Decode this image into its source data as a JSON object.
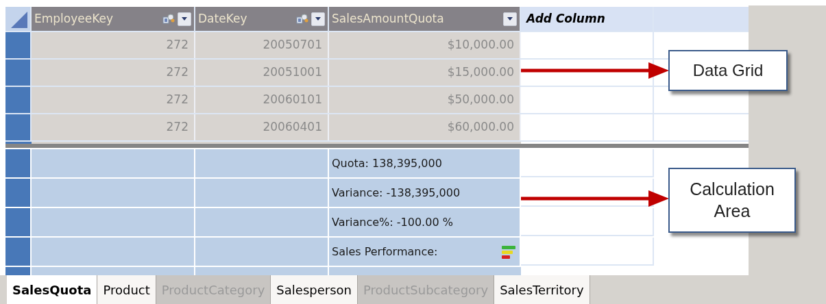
{
  "columns": [
    {
      "label": "EmployeeKey",
      "has_relationship": true,
      "has_filter": true
    },
    {
      "label": "DateKey",
      "has_relationship": true,
      "has_filter": true
    },
    {
      "label": "SalesAmountQuota",
      "has_relationship": false,
      "has_filter": true
    }
  ],
  "add_column": "Add Column",
  "rows": [
    [
      "272",
      "20050701",
      "$10,000.00"
    ],
    [
      "272",
      "20051001",
      "$15,000.00"
    ],
    [
      "272",
      "20060101",
      "$50,000.00"
    ],
    [
      "272",
      "20060401",
      "$60,000.00"
    ]
  ],
  "calculations": [
    {
      "text": "Quota: 138,395,000",
      "kind": "measure"
    },
    {
      "text": "Variance: -138,395,000",
      "kind": "measure"
    },
    {
      "text": "Variance%: -100.00 %",
      "kind": "measure"
    },
    {
      "text": "Sales Performance:",
      "kind": "kpi"
    }
  ],
  "callouts": [
    {
      "text": "Data Grid"
    },
    {
      "text": "Calculation Area"
    }
  ],
  "tabs": [
    {
      "label": "SalesQuota",
      "selected": true,
      "dimmed": false
    },
    {
      "label": "Product",
      "selected": false,
      "dimmed": false
    },
    {
      "label": "ProductCategory",
      "selected": false,
      "dimmed": true
    },
    {
      "label": "Salesperson",
      "selected": false,
      "dimmed": false
    },
    {
      "label": "ProductSubcategory",
      "selected": false,
      "dimmed": true
    },
    {
      "label": "SalesTerritory",
      "selected": false,
      "dimmed": false
    }
  ]
}
